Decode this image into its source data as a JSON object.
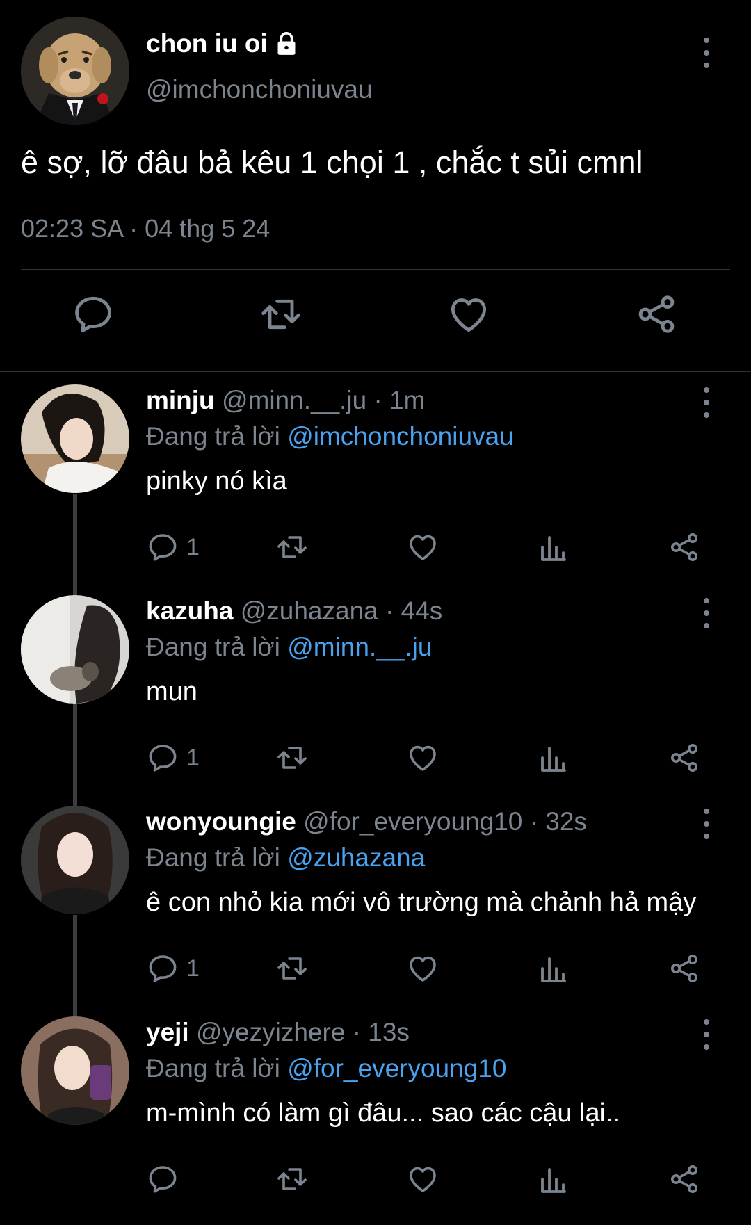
{
  "main_tweet": {
    "name": "chon iu oi",
    "handle": "@imchonchoniuvau",
    "text": "ê sợ, lỡ đâu bả kêu 1 chọi 1 , chắc t sủi cmnl",
    "timestamp": "02:23 SA · 04 thg 5 24",
    "actions": [
      "reply-icon",
      "retweet-icon",
      "like-icon",
      "share-icon"
    ]
  },
  "replies": [
    {
      "name": "minju",
      "meta": "@minn.__.ju · 1m",
      "replying_prefix": "Đang trả lời",
      "replying_to": "@imchonchoniuvau",
      "text": "pinky nó kìa",
      "reply_count": "1"
    },
    {
      "name": "kazuha",
      "meta": "@zuhazana · 44s",
      "replying_prefix": "Đang trả lời",
      "replying_to": "@minn.__.ju",
      "text": "mun",
      "reply_count": "1"
    },
    {
      "name": "wonyoungie",
      "meta": "@for_everyoung10 · 32s",
      "replying_prefix": "Đang trả lời",
      "replying_to": "@zuhazana",
      "text": "ê con nhỏ kia mới vô trường mà chảnh hả mậy",
      "reply_count": "1"
    },
    {
      "name": "yeji",
      "meta": "@yezyizhere · 13s",
      "replying_prefix": "Đang trả lời",
      "replying_to": "@for_everyoung10",
      "text": "m-mình có làm gì đâu... sao các cậu lại..",
      "reply_count": ""
    }
  ],
  "colors": {
    "background": "#000000",
    "text": "#ffffff",
    "muted": "#7c858f",
    "mention": "#4aa3f0",
    "divider": "#2f3336"
  }
}
